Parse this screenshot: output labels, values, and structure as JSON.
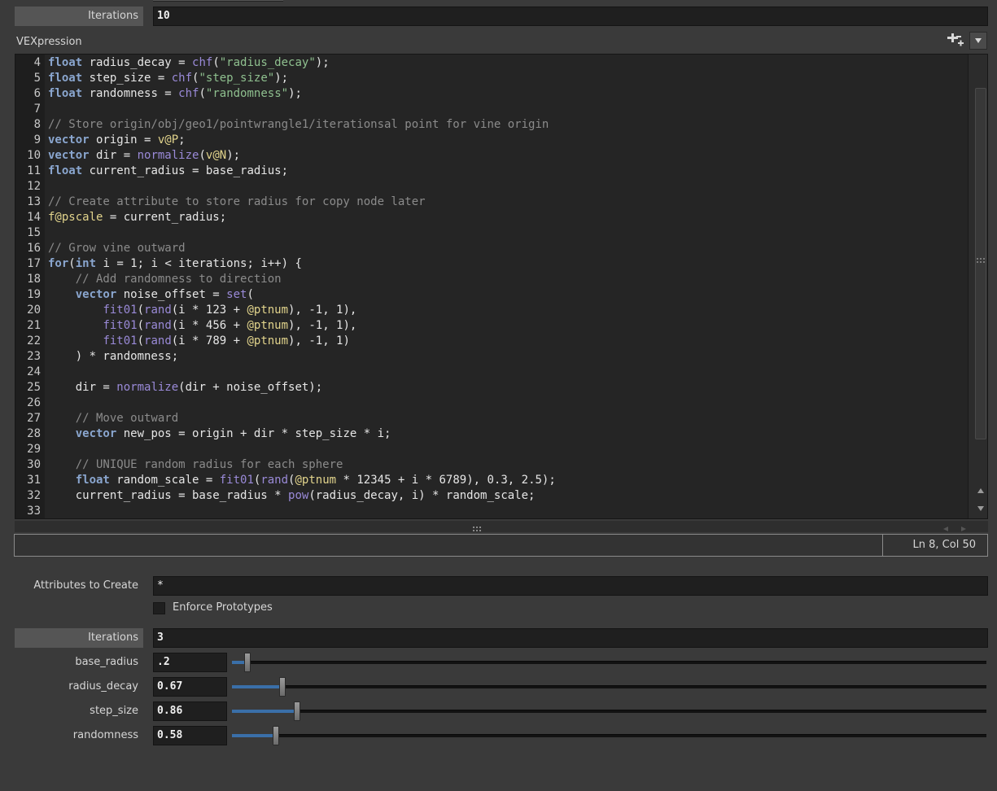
{
  "top_section": {
    "iterations_label": "Iterations",
    "iterations_value": "10"
  },
  "vex": {
    "label": "VEXpression",
    "lines": [
      {
        "n": "4",
        "tokens": [
          {
            "t": "float",
            "c": "kw"
          },
          {
            "t": " radius_decay = "
          },
          {
            "t": "chf",
            "c": "fn"
          },
          {
            "t": "("
          },
          {
            "t": "\"radius_decay\"",
            "c": "str"
          },
          {
            "t": ");"
          }
        ]
      },
      {
        "n": "5",
        "tokens": [
          {
            "t": "float",
            "c": "kw"
          },
          {
            "t": " step_size = "
          },
          {
            "t": "chf",
            "c": "fn"
          },
          {
            "t": "("
          },
          {
            "t": "\"step_size\"",
            "c": "str"
          },
          {
            "t": ");"
          }
        ]
      },
      {
        "n": "6",
        "tokens": [
          {
            "t": "float",
            "c": "kw"
          },
          {
            "t": " randomness = "
          },
          {
            "t": "chf",
            "c": "fn"
          },
          {
            "t": "("
          },
          {
            "t": "\"randomness\"",
            "c": "str"
          },
          {
            "t": ");"
          }
        ]
      },
      {
        "n": "7",
        "tokens": []
      },
      {
        "n": "8",
        "tokens": [
          {
            "t": "// Store origin/obj/geo1/pointwrangle1/iterationsal point for vine origin",
            "c": "cm"
          }
        ]
      },
      {
        "n": "9",
        "tokens": [
          {
            "t": "vector",
            "c": "kw"
          },
          {
            "t": " origin = "
          },
          {
            "t": "v@P",
            "c": "at"
          },
          {
            "t": ";"
          }
        ]
      },
      {
        "n": "10",
        "tokens": [
          {
            "t": "vector",
            "c": "kw"
          },
          {
            "t": " dir = "
          },
          {
            "t": "normalize",
            "c": "fn"
          },
          {
            "t": "("
          },
          {
            "t": "v@N",
            "c": "at"
          },
          {
            "t": ");"
          }
        ]
      },
      {
        "n": "11",
        "tokens": [
          {
            "t": "float",
            "c": "kw"
          },
          {
            "t": " current_radius = base_radius;"
          }
        ]
      },
      {
        "n": "12",
        "tokens": []
      },
      {
        "n": "13",
        "tokens": [
          {
            "t": "// Create attribute to store radius for copy node later",
            "c": "cm"
          }
        ]
      },
      {
        "n": "14",
        "tokens": [
          {
            "t": "f@pscale",
            "c": "at"
          },
          {
            "t": " = current_radius;"
          }
        ]
      },
      {
        "n": "15",
        "tokens": []
      },
      {
        "n": "16",
        "tokens": [
          {
            "t": "// Grow vine outward",
            "c": "cm"
          }
        ]
      },
      {
        "n": "17",
        "tokens": [
          {
            "t": "for",
            "c": "kw"
          },
          {
            "t": "("
          },
          {
            "t": "int",
            "c": "kw"
          },
          {
            "t": " i = 1; i < iterations; i++) {"
          }
        ]
      },
      {
        "n": "18",
        "tokens": [
          {
            "t": "    "
          },
          {
            "t": "// Add randomness to direction",
            "c": "cm"
          }
        ]
      },
      {
        "n": "19",
        "tokens": [
          {
            "t": "    "
          },
          {
            "t": "vector",
            "c": "kw"
          },
          {
            "t": " noise_offset = "
          },
          {
            "t": "set",
            "c": "fn"
          },
          {
            "t": "("
          }
        ]
      },
      {
        "n": "20",
        "tokens": [
          {
            "t": "        "
          },
          {
            "t": "fit01",
            "c": "fn"
          },
          {
            "t": "("
          },
          {
            "t": "rand",
            "c": "fn"
          },
          {
            "t": "(i * 123 + "
          },
          {
            "t": "@ptnum",
            "c": "at"
          },
          {
            "t": "), -1, 1),"
          }
        ]
      },
      {
        "n": "21",
        "tokens": [
          {
            "t": "        "
          },
          {
            "t": "fit01",
            "c": "fn"
          },
          {
            "t": "("
          },
          {
            "t": "rand",
            "c": "fn"
          },
          {
            "t": "(i * 456 + "
          },
          {
            "t": "@ptnum",
            "c": "at"
          },
          {
            "t": "), -1, 1),"
          }
        ]
      },
      {
        "n": "22",
        "tokens": [
          {
            "t": "        "
          },
          {
            "t": "fit01",
            "c": "fn"
          },
          {
            "t": "("
          },
          {
            "t": "rand",
            "c": "fn"
          },
          {
            "t": "(i * 789 + "
          },
          {
            "t": "@ptnum",
            "c": "at"
          },
          {
            "t": "), -1, 1)"
          }
        ]
      },
      {
        "n": "23",
        "tokens": [
          {
            "t": "    ) * randomness;"
          }
        ]
      },
      {
        "n": "24",
        "tokens": []
      },
      {
        "n": "25",
        "tokens": [
          {
            "t": "    dir = "
          },
          {
            "t": "normalize",
            "c": "fn"
          },
          {
            "t": "(dir + noise_offset);"
          }
        ]
      },
      {
        "n": "26",
        "tokens": []
      },
      {
        "n": "27",
        "tokens": [
          {
            "t": "    "
          },
          {
            "t": "// Move outward",
            "c": "cm"
          }
        ]
      },
      {
        "n": "28",
        "tokens": [
          {
            "t": "    "
          },
          {
            "t": "vector",
            "c": "kw"
          },
          {
            "t": " new_pos = origin + dir * step_size * i;"
          }
        ]
      },
      {
        "n": "29",
        "tokens": []
      },
      {
        "n": "30",
        "tokens": [
          {
            "t": "    "
          },
          {
            "t": "// UNIQUE random radius for each sphere",
            "c": "cm"
          }
        ]
      },
      {
        "n": "31",
        "tokens": [
          {
            "t": "    "
          },
          {
            "t": "float",
            "c": "kw"
          },
          {
            "t": " random_scale = "
          },
          {
            "t": "fit01",
            "c": "fn"
          },
          {
            "t": "("
          },
          {
            "t": "rand",
            "c": "fn"
          },
          {
            "t": "("
          },
          {
            "t": "@ptnum",
            "c": "at"
          },
          {
            "t": " * 12345 + i * 6789), 0.3, 2.5);"
          }
        ]
      },
      {
        "n": "32",
        "tokens": [
          {
            "t": "    current_radius = base_radius * "
          },
          {
            "t": "pow",
            "c": "fn"
          },
          {
            "t": "(radius_decay, i) * random_scale;"
          }
        ]
      },
      {
        "n": "33",
        "tokens": []
      }
    ],
    "cursor_position": "Ln 8, Col 50"
  },
  "attributes": {
    "label": "Attributes to Create",
    "value": "*",
    "enforce_label": "Enforce Prototypes",
    "enforce_checked": false
  },
  "params": {
    "iterations_label": "Iterations",
    "iterations_value": "3",
    "sliders": [
      {
        "label": "base_radius",
        "value": ".2",
        "level": 0.02
      },
      {
        "label": "radius_decay",
        "value": "0.67",
        "level": 0.067
      },
      {
        "label": "step_size",
        "value": "0.86",
        "level": 0.086
      },
      {
        "label": "randomness",
        "value": "0.58",
        "level": 0.058
      }
    ]
  },
  "colors": {
    "background": "#3a3a3a",
    "editor_bg": "#252525",
    "keyword": "#8aa6cf",
    "function": "#9a8ad8",
    "string": "#8fc08f",
    "attribute": "#e2d48c",
    "comment": "#8b8b8b",
    "slider_fill": "#3a6fa8"
  },
  "icons": [
    "add-parameter-icon",
    "dropdown-arrow-icon",
    "scroll-up-icon",
    "scroll-down-icon",
    "scroll-left-icon",
    "scroll-right-icon",
    "resize-grip-icon"
  ]
}
